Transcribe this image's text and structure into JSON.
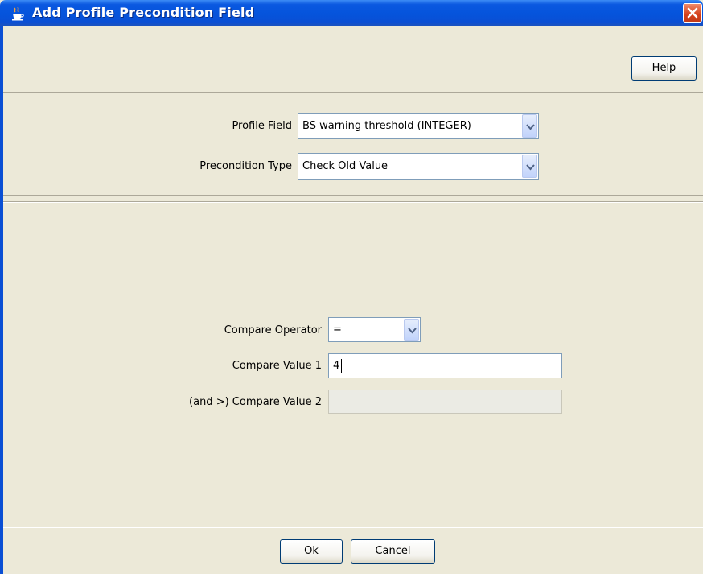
{
  "window": {
    "title": "Add Profile Precondition Field",
    "app_icon": "java-cup-icon",
    "close_icon": "close-x-icon"
  },
  "toolbar": {
    "help_label": "Help"
  },
  "form_top": {
    "profile_field_label": "Profile Field",
    "profile_field_value": "BS warning threshold (INTEGER)",
    "precondition_type_label": "Precondition Type",
    "precondition_type_value": "Check Old Value"
  },
  "form_compare": {
    "operator_label": "Compare Operator",
    "operator_value": "=",
    "value1_label": "Compare Value 1",
    "value1_value": "4",
    "value2_label": "(and >) Compare Value 2",
    "value2_value": ""
  },
  "footer": {
    "ok_label": "Ok",
    "cancel_label": "Cancel"
  },
  "colors": {
    "titlebar": "#0554dc",
    "dialog_bg": "#ece9d8",
    "field_border": "#7f9db9",
    "close_button": "#d4401c"
  }
}
